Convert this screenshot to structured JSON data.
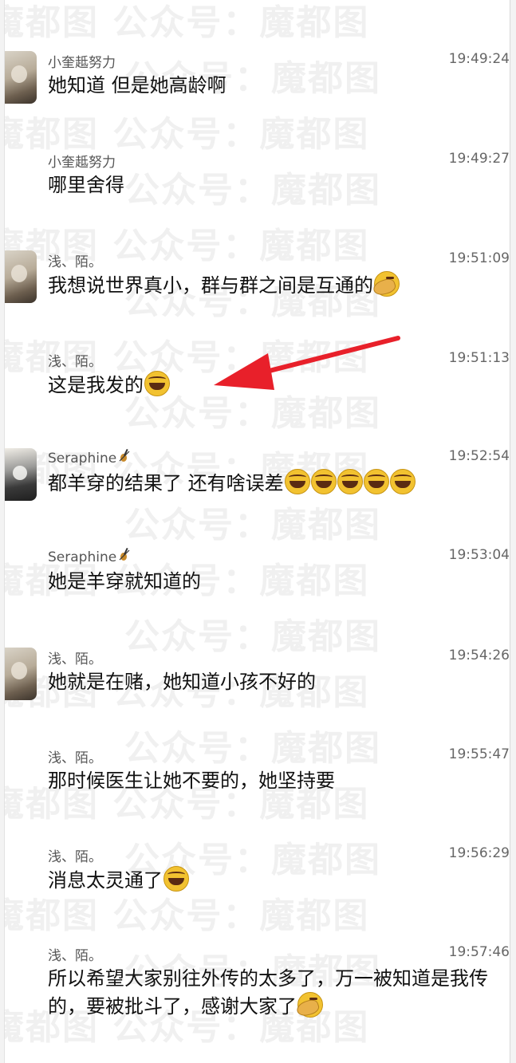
{
  "watermark": {
    "text_a": "魔都图",
    "text_b": "公众号：魔都图"
  },
  "messages": [
    {
      "sender": "小奎趆努力",
      "time": "19:49:24",
      "text": "她知道 但是她高龄啊",
      "emoji": [],
      "avatar": "avatar-icon"
    },
    {
      "sender": "小奎趆努力",
      "time": "19:49:27",
      "text": "哪里舍得",
      "emoji": [],
      "avatar": ""
    },
    {
      "sender": "浅、陌。",
      "time": "19:51:09",
      "text": "我想说世界真小，群与群之间是互通的",
      "emoji": [
        "facepalm"
      ],
      "avatar": "avatar-icon"
    },
    {
      "sender": "浅、陌。",
      "time": "19:51:13",
      "text": "这是我发的",
      "emoji": [
        "laugh"
      ],
      "avatar": ""
    },
    {
      "sender": "Seraphine",
      "time": "19:52:54",
      "text": "都羊穿的结果了 还有啥误差",
      "emoji": [
        "laugh",
        "laugh",
        "laugh",
        "laugh",
        "laugh"
      ],
      "avatar": "cat-avatar-icon",
      "badge": "violin-icon"
    },
    {
      "sender": "Seraphine",
      "time": "19:53:04",
      "text": "她是羊穿就知道的",
      "emoji": [],
      "avatar": "",
      "badge": "violin-icon"
    },
    {
      "sender": "浅、陌。",
      "time": "19:54:26",
      "text": "她就是在赌，她知道小孩不好的",
      "emoji": [],
      "avatar": "avatar-icon"
    },
    {
      "sender": "浅、陌。",
      "time": "19:55:47",
      "text": "那时候医生让她不要的，她坚持要",
      "emoji": [],
      "avatar": ""
    },
    {
      "sender": "浅、陌。",
      "time": "19:56:29",
      "text": "消息太灵通了",
      "emoji": [
        "laugh"
      ],
      "avatar": ""
    },
    {
      "sender": "浅、陌。",
      "time": "19:57:46",
      "text": "所以希望大家别往外传的太多了，万一被知道是我传的，要被批斗了，感谢大家了",
      "emoji": [
        "facepalm"
      ],
      "avatar": ""
    }
  ],
  "annotation": {
    "color": "#e8202a",
    "icon": "red-arrow-icon"
  }
}
